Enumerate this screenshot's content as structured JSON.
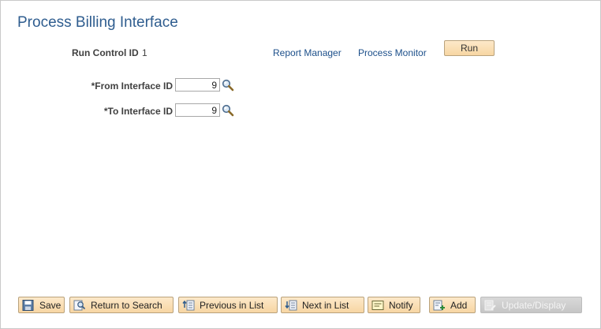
{
  "page": {
    "title": "Process Billing Interface"
  },
  "run_control": {
    "label": "Run Control ID",
    "value": "1"
  },
  "links": {
    "report_manager": "Report Manager",
    "process_monitor": "Process Monitor"
  },
  "run_button": "Run",
  "fields": {
    "from_interface": {
      "label": "*From Interface ID",
      "value": "9"
    },
    "to_interface": {
      "label": "*To Interface ID",
      "value": "9"
    }
  },
  "toolbar": {
    "save": "Save",
    "return_to_search": "Return to Search",
    "previous_in_list": "Previous in List",
    "next_in_list": "Next in List",
    "notify": "Notify",
    "add": "Add",
    "update_display": "Update/Display"
  },
  "colors": {
    "title": "#2f5d8f",
    "link": "#1c4f8a",
    "button_bg": "#f7d6a3",
    "button_border": "#b9a27c",
    "disabled_bg": "#c6c6c6"
  },
  "icons": {
    "lookup": "magnifier-icon",
    "save": "save-icon",
    "return_to_search": "return-to-search-icon",
    "previous_in_list": "previous-in-list-icon",
    "next_in_list": "next-in-list-icon",
    "notify": "notify-icon",
    "add": "add-icon",
    "update_display": "update-display-icon"
  }
}
